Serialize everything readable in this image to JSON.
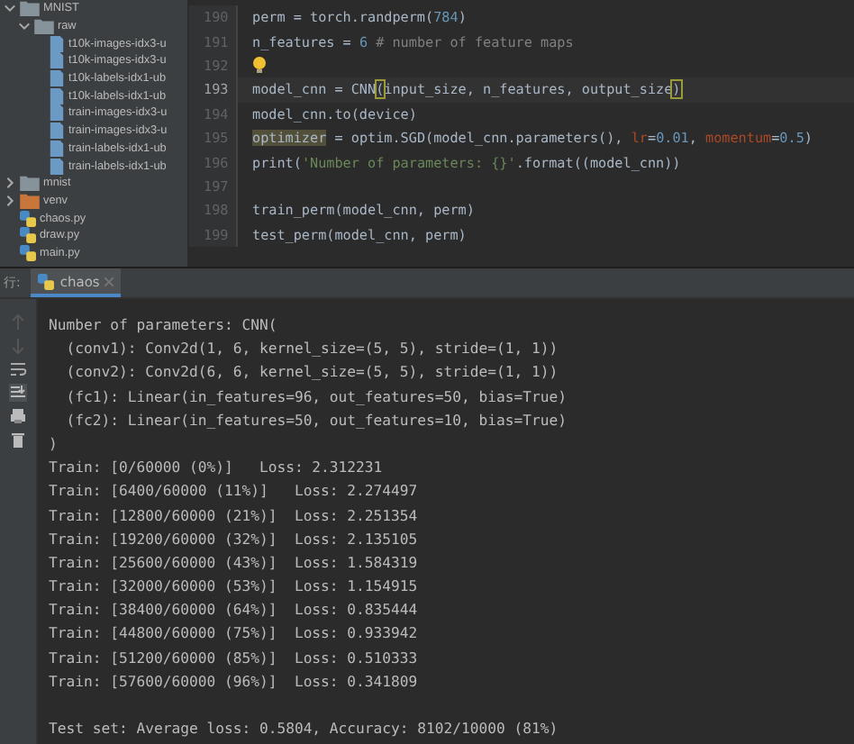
{
  "project_tree": [
    {
      "label": "MNIST",
      "kind": "folder",
      "expanded": true,
      "children": [
        {
          "label": "raw",
          "kind": "folder",
          "expanded": true,
          "children": [
            {
              "label": "t10k-images-idx3-u",
              "kind": "file"
            },
            {
              "label": "t10k-images-idx3-u",
              "kind": "file"
            },
            {
              "label": "t10k-labels-idx1-ub",
              "kind": "file"
            },
            {
              "label": "t10k-labels-idx1-ub",
              "kind": "file"
            },
            {
              "label": "train-images-idx3-u",
              "kind": "file"
            },
            {
              "label": "train-images-idx3-u",
              "kind": "file"
            },
            {
              "label": "train-labels-idx1-ub",
              "kind": "file"
            },
            {
              "label": "train-labels-idx1-ub",
              "kind": "file"
            }
          ]
        }
      ]
    },
    {
      "label": "mnist",
      "kind": "folder",
      "expanded": false
    },
    {
      "label": "venv",
      "kind": "venv",
      "expanded": false
    },
    {
      "label": "chaos.py",
      "kind": "python"
    },
    {
      "label": "draw.py",
      "kind": "python"
    },
    {
      "label": "main.py",
      "kind": "python"
    }
  ],
  "editor": {
    "lines": [
      {
        "number": "190",
        "current": false,
        "tokens": [
          {
            "text": "perm = torch.randperm(",
            "kind": "plain"
          },
          {
            "text": "784",
            "kind": "number"
          },
          {
            "text": ")",
            "kind": "plain"
          }
        ]
      },
      {
        "number": "191",
        "current": false,
        "tokens": [
          {
            "text": "n_features = ",
            "kind": "plain"
          },
          {
            "text": "6",
            "kind": "number"
          },
          {
            "text": " # number of feature maps",
            "kind": "comment"
          }
        ]
      },
      {
        "number": "192",
        "current": false,
        "bulb": true
      },
      {
        "number": "193",
        "current": true,
        "tokens": [
          {
            "text": "model_cnn = CNN",
            "kind": "plain"
          },
          {
            "text": "(",
            "kind": "brace"
          },
          {
            "text": "input_size, n_features, output_size",
            "kind": "plain"
          },
          {
            "text": ")",
            "kind": "brace"
          }
        ]
      },
      {
        "number": "194",
        "current": false,
        "tokens": [
          {
            "text": "model_cnn.to(device)",
            "kind": "plain"
          }
        ]
      },
      {
        "number": "195",
        "current": false,
        "tokens": [
          {
            "text": "optimizer",
            "kind": "warning"
          },
          {
            "text": " = optim.SGD(model_cnn.parameters(), ",
            "kind": "plain"
          },
          {
            "text": "lr",
            "kind": "param"
          },
          {
            "text": "=",
            "kind": "plain"
          },
          {
            "text": "0.01",
            "kind": "number"
          },
          {
            "text": ", ",
            "kind": "plain"
          },
          {
            "text": "momentum",
            "kind": "param"
          },
          {
            "text": "=",
            "kind": "plain"
          },
          {
            "text": "0.5",
            "kind": "number"
          },
          {
            "text": ")",
            "kind": "plain"
          }
        ]
      },
      {
        "number": "196",
        "current": false,
        "tokens": [
          {
            "text": "print(",
            "kind": "plain"
          },
          {
            "text": "'Number of parameters: {}'",
            "kind": "string"
          },
          {
            "text": ".format((model_cnn))",
            "kind": "plain"
          }
        ]
      },
      {
        "number": "197",
        "current": false
      },
      {
        "number": "198",
        "current": false,
        "tokens": [
          {
            "text": "train_perm(model_cnn, perm)",
            "kind": "plain"
          }
        ]
      },
      {
        "number": "199",
        "current": false,
        "tokens": [
          {
            "text": "test_perm(model_cnn, perm)",
            "kind": "plain"
          }
        ]
      }
    ]
  },
  "run_panel": {
    "label": "行:",
    "tabs": [
      {
        "label": "chaos",
        "selected": true
      }
    ],
    "console": [
      {
        "text": "Number of parameters: CNN(",
        "kind": "output"
      },
      {
        "text": "  (conv1): Conv2d(1, 6, kernel_size=(5, 5), stride=(1, 1))",
        "kind": "output"
      },
      {
        "text": "  (conv2): Conv2d(6, 6, kernel_size=(5, 5), stride=(1, 1))",
        "kind": "output"
      },
      {
        "text": "  (fc1): Linear(in_features=96, out_features=50, bias=True)",
        "kind": "output"
      },
      {
        "text": "  (fc2): Linear(in_features=50, out_features=10, bias=True)",
        "kind": "output"
      },
      {
        "text": ")",
        "kind": "output"
      },
      {
        "text": "Train: [0/60000 (0%)]   Loss: 2.312231",
        "kind": "output"
      },
      {
        "text": "Train: [6400/60000 (11%)]   Loss: 2.274497",
        "kind": "output"
      },
      {
        "text": "Train: [12800/60000 (21%)]  Loss: 2.251354",
        "kind": "output"
      },
      {
        "text": "Train: [19200/60000 (32%)]  Loss: 2.135105",
        "kind": "output"
      },
      {
        "text": "Train: [25600/60000 (43%)]  Loss: 1.584319",
        "kind": "output"
      },
      {
        "text": "Train: [32000/60000 (53%)]  Loss: 1.154915",
        "kind": "output"
      },
      {
        "text": "Train: [38400/60000 (64%)]  Loss: 0.835444",
        "kind": "output"
      },
      {
        "text": "Train: [44800/60000 (75%)]  Loss: 0.933942",
        "kind": "output"
      },
      {
        "text": "Train: [51200/60000 (85%)]  Loss: 0.510333",
        "kind": "output"
      },
      {
        "text": "Train: [57600/60000 (96%)]  Loss: 0.341809",
        "kind": "output"
      },
      {
        "text": "Test set: Average loss: 0.5804, Accuracy: 8102/10000 (81%)",
        "kind": "summary"
      }
    ]
  }
}
